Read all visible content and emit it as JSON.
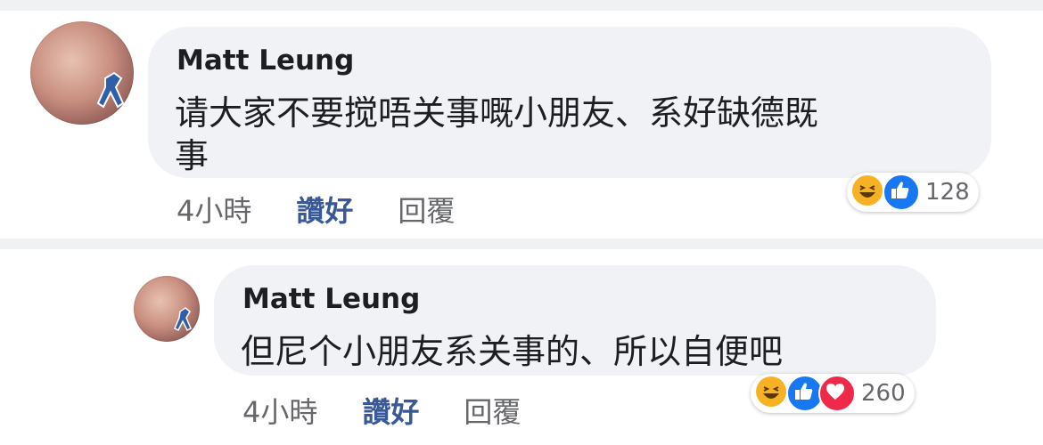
{
  "comments": [
    {
      "author": "Matt Leung",
      "text_line1": "请大家不要搅唔关事嘅小朋友、系好缺德既",
      "text_line2": "事",
      "time": "4小時",
      "like_label": "讚好",
      "reply_label": "回覆",
      "reaction_icons": [
        "haha-icon",
        "like-icon"
      ],
      "reaction_count": "128"
    },
    {
      "author": "Matt Leung",
      "text_line1": "但尼个小朋友系关事的、所以自便吧",
      "time": "4小時",
      "like_label": "讚好",
      "reply_label": "回覆",
      "reaction_icons": [
        "haha-icon",
        "like-icon",
        "love-icon"
      ],
      "reaction_count": "260"
    }
  ],
  "colors": {
    "bubble": "#f0f2f5",
    "like_link": "#385898",
    "meta_text": "#65676b",
    "like_reaction": "#1877f2",
    "love_reaction": "#f0284a",
    "haha_reaction": "#f7b125"
  }
}
